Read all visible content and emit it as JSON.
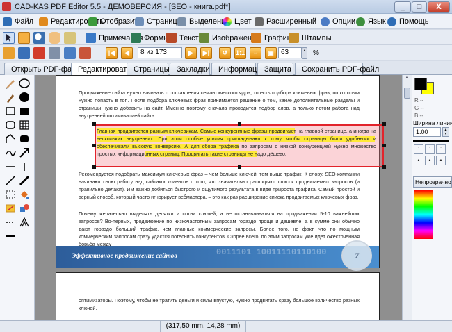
{
  "window": {
    "title": "CAD-KAS PDF Editor 5.5 - ДЕМОВЕРСИЯ - [SEO - книга.pdf*]",
    "buttons": [
      "_",
      "□",
      "X"
    ]
  },
  "menu": [
    {
      "label": "Файл",
      "icon": "save-icon",
      "color": "#2f6db5"
    },
    {
      "label": "Редактировать",
      "icon": "edit-pencil-icon",
      "color": "#e08a1e"
    },
    {
      "label": "Отобразить",
      "icon": "view-icon",
      "color": "#3c9a3c"
    },
    {
      "label": "Страница",
      "icon": "page-icon",
      "color": "#6f8fb8"
    },
    {
      "label": "Выделение",
      "icon": "selection-icon",
      "color": "#7a8fa8"
    },
    {
      "label": "Цвет",
      "icon": "color-wheel-icon",
      "color": "#d04a9a"
    },
    {
      "label": "Расширенный",
      "icon": "advanced-icon",
      "color": "#6a6a6a"
    },
    {
      "label": "Опции",
      "icon": "options-gear-icon",
      "color": "#4b7bc4"
    },
    {
      "label": "Язык",
      "icon": "language-globe-icon",
      "color": "#3e8f3e"
    },
    {
      "label": "Помощь",
      "icon": "help-icon",
      "color": "#2f6db5"
    }
  ],
  "toolbar1": [
    {
      "label": "Примечания",
      "icon": "notes-icon",
      "color": "#3a79c6"
    },
    {
      "label": "Формы",
      "icon": "forms-icon",
      "color": "#2d7a55"
    },
    {
      "label": "Текст",
      "icon": "text-icon",
      "color": "#b84a28"
    },
    {
      "label": "Изображения",
      "icon": "images-icon",
      "color": "#6a8a3a"
    },
    {
      "label": "Графика",
      "icon": "graphics-icon",
      "color": "#d67a1a"
    },
    {
      "label": "Штампы",
      "icon": "stamps-icon",
      "color": "#c8902a"
    }
  ],
  "toolbar2": {
    "page_field": "8 из 173",
    "zoom_field": "63",
    "percent": "%"
  },
  "tabs": [
    {
      "label": "Открыть PDF-файл",
      "icon": "open-folder-icon",
      "color": "#e0a020"
    },
    {
      "label": "Редактировать",
      "icon": "edit-icon",
      "color": "#3a79c6"
    },
    {
      "label": "Страницы",
      "icon": "pages-icon",
      "color": "#3a79c6"
    },
    {
      "label": "Закладки",
      "icon": "bookmarks-icon",
      "color": "#3a79c6"
    },
    {
      "label": "Информация",
      "icon": "info-icon",
      "color": "#3a79c6"
    },
    {
      "label": "Защита",
      "icon": "lock-icon",
      "color": "#d0a020"
    },
    {
      "label": "Сохранить PDF-файл",
      "icon": "save-pdf-icon",
      "color": "#3e9a4a"
    }
  ],
  "document": {
    "p1": "Продвижение сайта нужно начинать с составления семантического ядра, то есть подбора ключевых фраз, по которым нужно попасть в топ. После подбора ключевых фраз принимается решение о том, какие дополнительные разделы и страницы нужно добавить на сайт. Именно поэтому сначала проводится подбор слов, а только потом работа над внутренней оптимизацией сайта.",
    "p2": "Главная продвигается разным ключевикам. Самые конкурентные фразы продвигают на главной странице, а иногда на нескольких внутренних. При этом особые усилия прикладывают к тому, чтобы страницы были удобными и обеспечивали высокую конверсию. А для сбора трафика по запросам с низкой конкуренцией нужно множество простых информационных страниц. Продвигать такие страницы не надо дёшево.",
    "p3": "Рекомендуется подобрать максимум ключевых фраз – чем больше ключей, тем выше трафик. К слову, SEO-компании начинают свою работу над сайтами клиентов с того, что значительно расширяют список продвигаемых запросов (и правильно делают). Им важно добиться быстрого и ощутимого результата в виде прироста трафика. Самый простой и верный способ, который часто игнорирует вебмастера, – это как раз расширение списка продвигаемых ключевых фраз.",
    "p4": "Почему желательно выделять десятки и сотни ключей, а не останавливаться на продвижении 5-10 важнейших запросов? Во-первых, продвижение по низкочастотным запросам гораздо проще и дешевле, а в сумме они обычно дают гораздо больший трафик, чем главные коммерческие запросы. Более того, не факт, что по мощным коммерческим запросам сразу удастся потеснить конкурентов. Скорее всего, по этим запросам уже идет ожесточенная борьба между",
    "banner": "Эффективное продвижение сайтов",
    "banner_binary": "0011101 10011110110100",
    "banner_page": "7",
    "p5": "оптимизаторы. Поэтому, чтобы не тратить деньги и силы впустую, нужно продвигать сразу большое количество разных ключей."
  },
  "right_panel": {
    "rgb_labels": [
      "R --",
      "G --",
      "B --"
    ],
    "line_width_label": "Ширина линии:",
    "line_width_value": "1.00",
    "opacity_button": "Непрозрачно",
    "fg_color": "#000000",
    "bg_color": "#ffff00"
  },
  "status": {
    "coords": "(317,50 mm, 14,28 mm)"
  }
}
